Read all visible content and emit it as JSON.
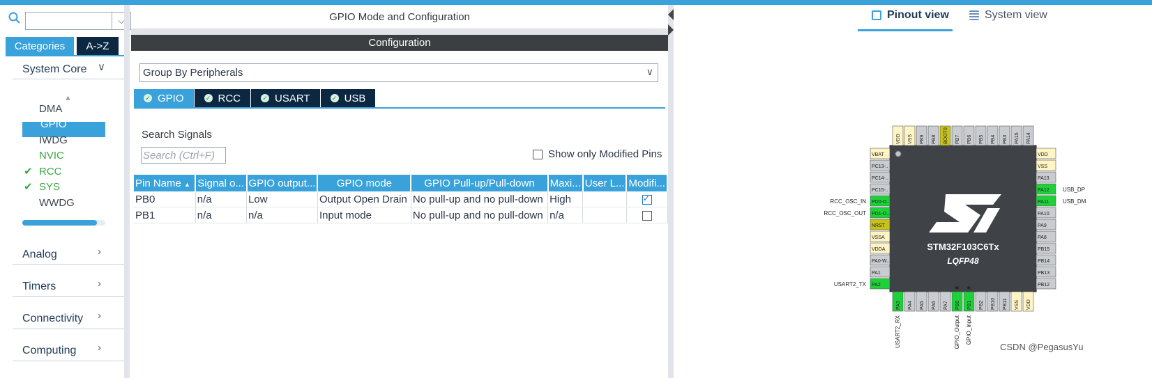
{
  "window": {
    "center_title": "GPIO Mode and Configuration"
  },
  "sidebar": {
    "search_value": "",
    "tabs": [
      "Categories",
      "A->Z"
    ],
    "system_core_label": "System Core",
    "items": [
      {
        "label": "DMA",
        "status": "none"
      },
      {
        "label": "GPIO",
        "status": "selected"
      },
      {
        "label": "IWDG",
        "status": "none"
      },
      {
        "label": "NVIC",
        "status": "green"
      },
      {
        "label": "RCC",
        "status": "check"
      },
      {
        "label": "SYS",
        "status": "check"
      },
      {
        "label": "WWDG",
        "status": "none"
      }
    ],
    "scroll_fraction": 0.9,
    "groups": [
      "Analog",
      "Timers",
      "Connectivity",
      "Computing"
    ]
  },
  "config": {
    "header": "Configuration",
    "group_by": "Group By Peripherals",
    "peripheral_tabs": [
      "GPIO",
      "RCC",
      "USART",
      "USB"
    ],
    "search_signals_label": "Search Signals",
    "search_placeholder": "Search (Ctrl+F)",
    "show_modified_label": "Show only Modified Pins",
    "table": {
      "headers": [
        "Pin Name",
        "Signal o...",
        "GPIO output...",
        "GPIO mode",
        "GPIO Pull-up/Pull-down",
        "Maxi...",
        "User L...",
        "Modifi..."
      ],
      "rows": [
        {
          "pin": "PB0",
          "signal": "n/a",
          "output": "Low",
          "mode": "Output Open Drain",
          "pull": "No pull-up and no pull-down",
          "max": "High",
          "user": "",
          "modified": true
        },
        {
          "pin": "PB1",
          "signal": "n/a",
          "output": "n/a",
          "mode": "Input mode",
          "pull": "No pull-up and no pull-down",
          "max": "n/a",
          "user": "",
          "modified": false
        }
      ]
    }
  },
  "view_tabs": {
    "pinout": "Pinout view",
    "system": "System view"
  },
  "chip": {
    "part": "STM32F103C6Tx",
    "package": "LQFP48",
    "top_pins": [
      "VDD",
      "VSS",
      "PB9",
      "PB8",
      "BOOT0",
      "PB7",
      "PB6",
      "PB5",
      "PB4",
      "PB3",
      "PA15",
      "PA14"
    ],
    "left_pins": [
      "VBAT",
      "PC13-..",
      "PC14-..",
      "PC15-..",
      "PD0-O..",
      "PD1-O..",
      "NRST",
      "VSSA",
      "VDDA",
      "PA0-W..",
      "PA1",
      "PA2"
    ],
    "right_pins": [
      "VDD",
      "VSS",
      "PA13",
      "PA12",
      "PA11",
      "PA10",
      "PA9",
      "PA8",
      "PB15",
      "PB14",
      "PB13",
      "PB12"
    ],
    "bottom_pins": [
      "PA3",
      "PA4",
      "PA5",
      "PA6",
      "PA7",
      "PB0",
      "PB1",
      "PB2",
      "PB10",
      "PB11",
      "VSS",
      "VDD"
    ],
    "green_pins": [
      "PD0-O..",
      "PD1-O..",
      "PA2",
      "PA3",
      "PB0",
      "PB1",
      "PA11",
      "PA12"
    ],
    "yellow_pins": [
      "VDD",
      "VSS",
      "VBAT",
      "VSSA",
      "VDDA"
    ],
    "olive_pins": [
      "BOOT0",
      "NRST"
    ],
    "left_labels": [
      {
        "pin": "PD0-O..",
        "text": "RCC_OSC_IN"
      },
      {
        "pin": "PD1-O..",
        "text": "RCC_OSC_OUT"
      },
      {
        "pin": "PA2",
        "text": "USART2_TX"
      }
    ],
    "right_labels": [
      {
        "pin": "PA12",
        "text": "USB_DP"
      },
      {
        "pin": "PA11",
        "text": "USB_DM"
      }
    ],
    "bottom_labels": [
      {
        "pin": "PA3",
        "text": "USART2_RX"
      },
      {
        "pin": "PB0",
        "text": "GPIO_Output"
      },
      {
        "pin": "PB1",
        "text": "GPIO_Input"
      }
    ],
    "colors": {
      "green": "#1ed13a",
      "yellow": "#fff4c4",
      "olive": "#c7c21a",
      "gray": "#c9ccd0",
      "body": "#3f4347"
    }
  },
  "watermark": "CSDN @PegasusYu"
}
